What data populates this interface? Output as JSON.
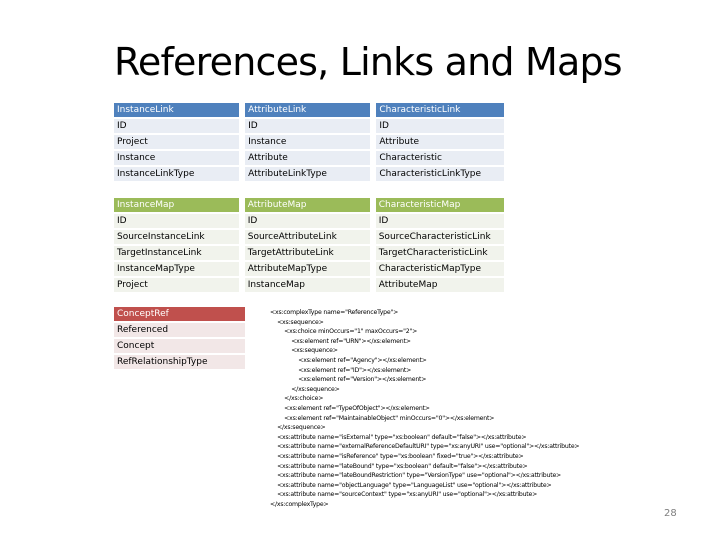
{
  "slide": {
    "title": "References, Links and Maps",
    "page_number": "28"
  },
  "link_tables": {
    "headers": [
      "InstanceLink",
      "AttributeLink",
      "CharacteristicLink"
    ],
    "rows": [
      [
        "ID",
        "ID",
        "ID"
      ],
      [
        "Project",
        "Instance",
        "Attribute"
      ],
      [
        "Instance",
        "Attribute",
        "Characteristic"
      ],
      [
        "InstanceLinkType",
        "AttributeLinkType",
        "CharacteristicLinkType"
      ]
    ]
  },
  "map_tables": {
    "headers": [
      "InstanceMap",
      "AttributeMap",
      "CharacteristicMap"
    ],
    "rows": [
      [
        "ID",
        "ID",
        "ID"
      ],
      [
        "SourceInstanceLink",
        "SourceAttributeLink",
        "SourceCharacteristicLink"
      ],
      [
        "TargetInstanceLink",
        "TargetAttributeLink",
        "TargetCharacteristicLink"
      ],
      [
        "InstanceMapType",
        "AttributeMapType",
        "CharacteristicMapType"
      ],
      [
        "Project",
        "InstanceMap",
        "AttributeMap"
      ]
    ]
  },
  "concept_ref_table": {
    "header": "ConceptRef",
    "rows": [
      "Referenced",
      "Concept",
      "RefRelationshipType"
    ]
  },
  "colors": {
    "link_header": "#4f81bd",
    "map_header": "#9bbb59",
    "concept_header": "#c0504d"
  },
  "code_lines": [
    "<xs:complexType name=\"ReferenceType\">",
    "    <xs:sequence>",
    "        <xs:choice minOccurs=\"1\" maxOccurs=\"2\">",
    "            <xs:element ref=\"URN\"></xs:element>",
    "            <xs:sequence>",
    "                <xs:element ref=\"Agency\"></xs:element>",
    "                <xs:element ref=\"ID\"></xs:element>",
    "                <xs:element ref=\"Version\"></xs:element>",
    "            </xs:sequence>",
    "        </xs:choice>",
    "        <xs:element ref=\"TypeOfObject\"></xs:element>",
    "        <xs:element ref=\"MaintainableObject\" minOccurs=\"0\"></xs:element>",
    "    </xs:sequence>",
    "    <xs:attribute name=\"isExternal\" type=\"xs:boolean\" default=\"false\"></xs:attribute>",
    "    <xs:attribute name=\"externalReferenceDefaultURI\" type=\"xs:anyURI\" use=\"optional\"></xs:attribute>",
    "    <xs:attribute name=\"isReference\" type=\"xs:boolean\" fixed=\"true\"></xs:attribute>",
    "    <xs:attribute name=\"lateBound\" type=\"xs:boolean\" default=\"false\"></xs:attribute>",
    "    <xs:attribute name=\"lateBoundRestriction\" type=\"VersionType\" use=\"optional\"></xs:attribute>",
    "    <xs:attribute name=\"objectLanguage\" type=\"LanguageList\" use=\"optional\"></xs:attribute>",
    "    <xs:attribute name=\"sourceContext\" type=\"xs:anyURI\" use=\"optional\"></xs:attribute>",
    "</xs:complexType>"
  ]
}
